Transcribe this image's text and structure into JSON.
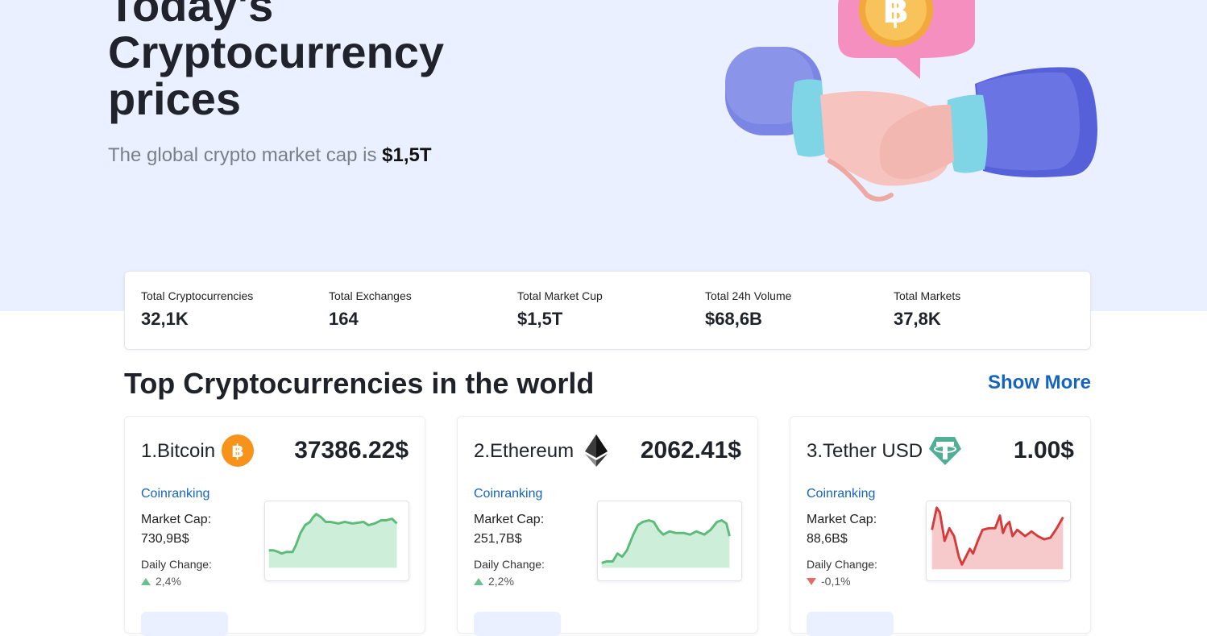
{
  "hero": {
    "title_line1": "Today's",
    "title_line2": "Cryptocurrency",
    "title_line3": "prices",
    "subtitle": "The global crypto market cap is",
    "subtitle_value": "$1,5T"
  },
  "stats": [
    {
      "label": "Total Cryptocurrencies",
      "value": "32,1K"
    },
    {
      "label": "Total Exchanges",
      "value": "164"
    },
    {
      "label": "Total Market Cup",
      "value": "$1,5T"
    },
    {
      "label": "Total 24h Volume",
      "value": "$68,6B"
    },
    {
      "label": "Total Markets",
      "value": "37,8K"
    }
  ],
  "section": {
    "title": "Top Cryptocurrencies in the world",
    "show_more": "Show More"
  },
  "cards": [
    {
      "name": "1.Bitcoin",
      "icon": "bitcoin-icon",
      "price": "37386.22$",
      "link": "Coinranking",
      "cap_label": "Market Cap:",
      "cap_value": "730,9B$",
      "change_label": "Daily Change:",
      "change_value": "2,4%",
      "trend": "up",
      "color": "#5dbb7a",
      "fill": "#cdeed8"
    },
    {
      "name": "2.Ethereum",
      "icon": "ethereum-icon",
      "price": "2062.41$",
      "link": "Coinranking",
      "cap_label": "Market Cap:",
      "cap_value": "251,7B$",
      "change_label": "Daily Change:",
      "change_value": "2,2%",
      "trend": "up",
      "color": "#5dbb7a",
      "fill": "#cdeed8"
    },
    {
      "name": "3.Tether USD",
      "icon": "tether-icon",
      "price": "1.00$",
      "link": "Coinranking",
      "cap_label": "Market Cap:",
      "cap_value": "88,6B$",
      "change_label": "Daily Change:",
      "change_value": "-0,1%",
      "trend": "down",
      "color": "#d43c3c",
      "fill": "#f6caca"
    }
  ]
}
